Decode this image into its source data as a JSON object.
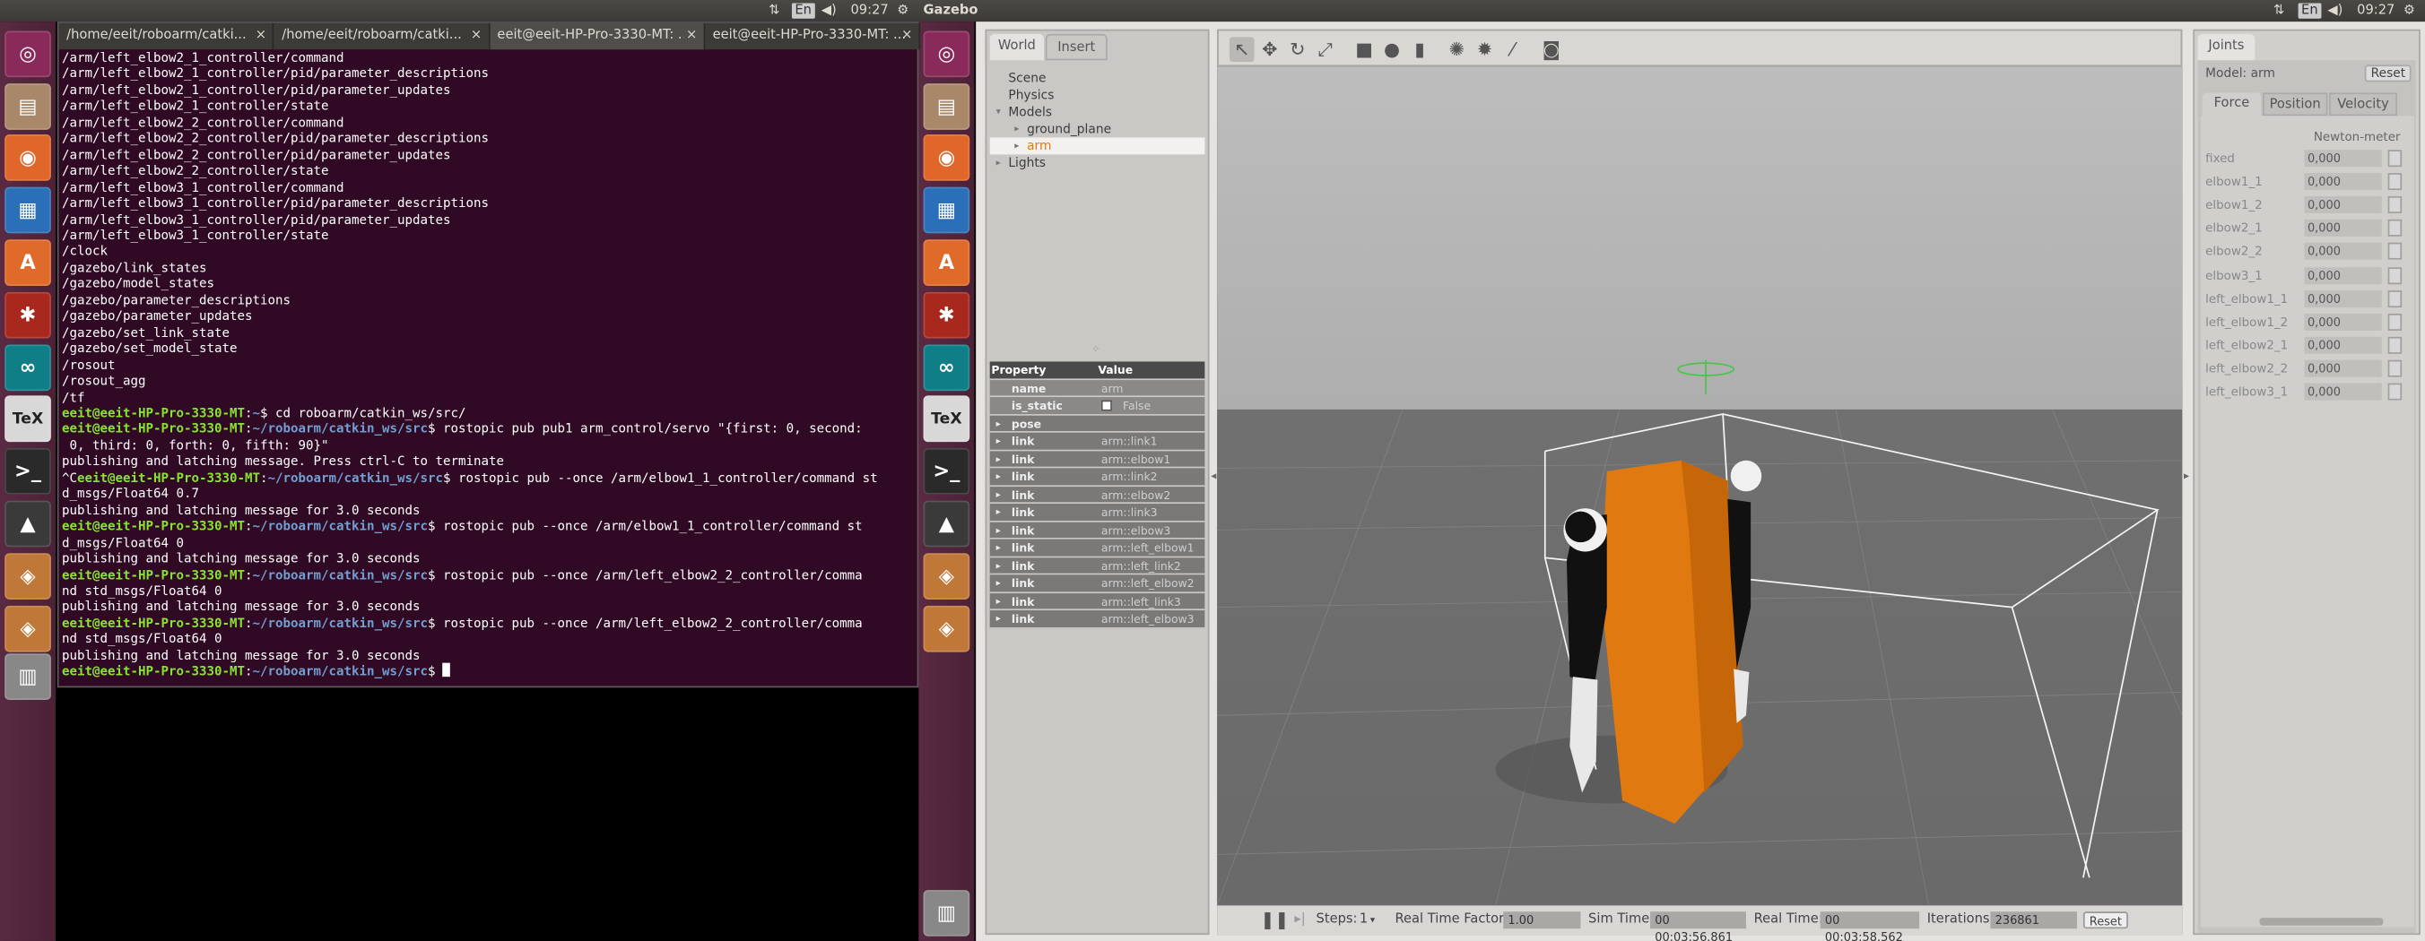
{
  "left_panel": {
    "indicators": [
      "⇅",
      "En",
      "◀)"
    ],
    "time": "09:27"
  },
  "right_panel": {
    "app_title": "Gazebo",
    "indicators": [
      "⇅",
      "En",
      "◀)"
    ],
    "time": "09:27"
  },
  "terminal": {
    "tabs": [
      "/home/eeit/roboarm/catki...",
      "/home/eeit/roboarm/catki...",
      "eeit@eeit-HP-Pro-3330-MT: ...",
      "eeit@eeit-HP-Pro-3330-MT: ..."
    ],
    "close_glyph": "×",
    "lines": [
      [
        {
          "t": "/arm/left_elbow2_1_controller/command"
        }
      ],
      [
        {
          "t": "/arm/left_elbow2_1_controller/pid/parameter_descriptions"
        }
      ],
      [
        {
          "t": "/arm/left_elbow2_1_controller/pid/parameter_updates"
        }
      ],
      [
        {
          "t": "/arm/left_elbow2_1_controller/state"
        }
      ],
      [
        {
          "t": "/arm/left_elbow2_2_controller/command"
        }
      ],
      [
        {
          "t": "/arm/left_elbow2_2_controller/pid/parameter_descriptions"
        }
      ],
      [
        {
          "t": "/arm/left_elbow2_2_controller/pid/parameter_updates"
        }
      ],
      [
        {
          "t": "/arm/left_elbow2_2_controller/state"
        }
      ],
      [
        {
          "t": "/arm/left_elbow3_1_controller/command"
        }
      ],
      [
        {
          "t": "/arm/left_elbow3_1_controller/pid/parameter_descriptions"
        }
      ],
      [
        {
          "t": "/arm/left_elbow3_1_controller/pid/parameter_updates"
        }
      ],
      [
        {
          "t": "/arm/left_elbow3_1_controller/state"
        }
      ],
      [
        {
          "t": "/clock"
        }
      ],
      [
        {
          "t": "/gazebo/link_states"
        }
      ],
      [
        {
          "t": "/gazebo/model_states"
        }
      ],
      [
        {
          "t": "/gazebo/parameter_descriptions"
        }
      ],
      [
        {
          "t": "/gazebo/parameter_updates"
        }
      ],
      [
        {
          "t": "/gazebo/set_link_state"
        }
      ],
      [
        {
          "t": "/gazebo/set_model_state"
        }
      ],
      [
        {
          "t": "/rosout"
        }
      ],
      [
        {
          "t": "/rosout_agg"
        }
      ],
      [
        {
          "t": "/tf"
        }
      ],
      [
        {
          "t": "eeit@eeit-HP-Pro-3330-MT",
          "c": "g"
        },
        {
          "t": ":"
        },
        {
          "t": "~",
          "c": "b"
        },
        {
          "t": "$ cd roboarm/catkin_ws/src/"
        }
      ],
      [
        {
          "t": "eeit@eeit-HP-Pro-3330-MT",
          "c": "g"
        },
        {
          "t": ":"
        },
        {
          "t": "~/roboarm/catkin_ws/src",
          "c": "b"
        },
        {
          "t": "$ rostopic pub pub1 arm_control/servo \"{first: 0, second:"
        }
      ],
      [
        {
          "t": " 0, third: 0, forth: 0, fifth: 90}\""
        }
      ],
      [
        {
          "t": "publishing and latching message. Press ctrl-C to terminate"
        }
      ],
      [
        {
          "t": "^C"
        },
        {
          "t": "eeit@eeit-HP-Pro-3330-MT",
          "c": "g"
        },
        {
          "t": ":"
        },
        {
          "t": "~/roboarm/catkin_ws/src",
          "c": "b"
        },
        {
          "t": "$ rostopic pub --once /arm/elbow1_1_controller/command st"
        }
      ],
      [
        {
          "t": "d_msgs/Float64 0.7"
        }
      ],
      [
        {
          "t": "publishing and latching message for 3.0 seconds"
        }
      ],
      [
        {
          "t": "eeit@eeit-HP-Pro-3330-MT",
          "c": "g"
        },
        {
          "t": ":"
        },
        {
          "t": "~/roboarm/catkin_ws/src",
          "c": "b"
        },
        {
          "t": "$ rostopic pub --once /arm/elbow1_1_controller/command st"
        }
      ],
      [
        {
          "t": "d_msgs/Float64 0"
        }
      ],
      [
        {
          "t": "publishing and latching message for 3.0 seconds"
        }
      ],
      [
        {
          "t": "eeit@eeit-HP-Pro-3330-MT",
          "c": "g"
        },
        {
          "t": ":"
        },
        {
          "t": "~/roboarm/catkin_ws/src",
          "c": "b"
        },
        {
          "t": "$ rostopic pub --once /arm/left_elbow2_2_controller/comma"
        }
      ],
      [
        {
          "t": "nd std_msgs/Float64 0"
        }
      ],
      [
        {
          "t": "publishing and latching message for 3.0 seconds"
        }
      ],
      [
        {
          "t": "eeit@eeit-HP-Pro-3330-MT",
          "c": "g"
        },
        {
          "t": ":"
        },
        {
          "t": "~/roboarm/catkin_ws/src",
          "c": "b"
        },
        {
          "t": "$ rostopic pub --once /arm/left_elbow2_2_controller/comma"
        }
      ],
      [
        {
          "t": "nd std_msgs/Float64 0"
        }
      ],
      [
        {
          "t": "publishing and latching message for 3.0 seconds"
        }
      ],
      [
        {
          "t": "eeit@eeit-HP-Pro-3330-MT",
          "c": "g"
        },
        {
          "t": ":"
        },
        {
          "t": "~/roboarm/catkin_ws/src",
          "c": "b"
        },
        {
          "t": "$ "
        },
        {
          "cursor": true
        }
      ]
    ]
  },
  "world_panel": {
    "tabs": [
      "World",
      "Insert"
    ],
    "tree": [
      {
        "label": "Scene",
        "indent": 12,
        "arrow": ""
      },
      {
        "label": "Physics",
        "indent": 12,
        "arrow": ""
      },
      {
        "label": "Models",
        "indent": 12,
        "arrow": "▾"
      },
      {
        "label": "ground_plane",
        "indent": 24,
        "arrow": "▸"
      },
      {
        "label": "arm",
        "indent": 24,
        "arrow": "▸",
        "selected": true
      },
      {
        "label": "Lights",
        "indent": 12,
        "arrow": "▸"
      }
    ],
    "props_header": {
      "property": "Property",
      "value": "Value"
    },
    "props": [
      {
        "k": "name",
        "v": "arm"
      },
      {
        "k": "is_static",
        "v": "False",
        "checkbox": true
      },
      {
        "k": "pose",
        "v": "",
        "expand": true
      },
      {
        "k": "link",
        "v": "arm::link1",
        "expand": true
      },
      {
        "k": "link",
        "v": "arm::elbow1",
        "expand": true
      },
      {
        "k": "link",
        "v": "arm::link2",
        "expand": true
      },
      {
        "k": "link",
        "v": "arm::elbow2",
        "expand": true
      },
      {
        "k": "link",
        "v": "arm::link3",
        "expand": true
      },
      {
        "k": "link",
        "v": "arm::elbow3",
        "expand": true
      },
      {
        "k": "link",
        "v": "arm::left_elbow1",
        "expand": true
      },
      {
        "k": "link",
        "v": "arm::left_link2",
        "expand": true
      },
      {
        "k": "link",
        "v": "arm::left_elbow2",
        "expand": true
      },
      {
        "k": "link",
        "v": "arm::left_link3",
        "expand": true
      },
      {
        "k": "link",
        "v": "arm::left_elbow3",
        "expand": true
      }
    ]
  },
  "status": {
    "steps_label": "Steps:",
    "steps_value": "1",
    "rtf_label": "Real Time Factor:",
    "rtf_value": "1.00",
    "sim_label": "Sim Time:",
    "sim_value": "00 00:03:56.861",
    "real_label": "Real Time:",
    "real_value": "00 00:03:58.562",
    "iter_label": "Iterations:",
    "iter_value": "236861",
    "reset": "Reset"
  },
  "joints": {
    "tab": "Joints",
    "model_label": "Model: arm",
    "reset": "Reset",
    "subtabs": [
      "Force",
      "Position",
      "Velocity"
    ],
    "unit": "Newton-meter",
    "rows": [
      {
        "name": "fixed",
        "value": "0,000"
      },
      {
        "name": "elbow1_1",
        "value": "0,000"
      },
      {
        "name": "elbow1_2",
        "value": "0,000"
      },
      {
        "name": "elbow2_1",
        "value": "0,000"
      },
      {
        "name": "elbow2_2",
        "value": "0,000"
      },
      {
        "name": "elbow3_1",
        "value": "0,000"
      },
      {
        "name": "left_elbow1_1",
        "value": "0,000"
      },
      {
        "name": "left_elbow1_2",
        "value": "0,000"
      },
      {
        "name": "left_elbow2_1",
        "value": "0,000"
      },
      {
        "name": "left_elbow2_2",
        "value": "0,000"
      },
      {
        "name": "left_elbow3_1",
        "value": "0,000"
      }
    ]
  },
  "launcher_icons": [
    {
      "name": "ubuntu-dash-icon",
      "glyph": "◎",
      "color": "#8a2a5a"
    },
    {
      "name": "files-icon",
      "glyph": "▤",
      "color": "#a9886a"
    },
    {
      "name": "firefox-icon",
      "glyph": "◉",
      "color": "#e0662a"
    },
    {
      "name": "writer-icon",
      "glyph": "▦",
      "color": "#2a6fb7"
    },
    {
      "name": "software-center-icon",
      "glyph": "A",
      "color": "#e06a2a"
    },
    {
      "name": "settings-icon",
      "glyph": "✱",
      "color": "#a8281e"
    },
    {
      "name": "arduino-icon",
      "glyph": "∞",
      "color": "#0f7e86"
    },
    {
      "name": "texmaker-icon",
      "glyph": "TeX",
      "color": "#d8d8d8"
    },
    {
      "name": "terminal-icon",
      "glyph": ">_",
      "color": "#2a2a2a"
    },
    {
      "name": "updater-icon",
      "glyph": "▲",
      "color": "#3a3a3a"
    },
    {
      "name": "package-icon",
      "glyph": "◈",
      "color": "#c07838"
    },
    {
      "name": "package2-icon",
      "glyph": "◈",
      "color": "#c07838"
    },
    {
      "name": "trash-icon",
      "glyph": "▥",
      "color": "#888"
    }
  ]
}
